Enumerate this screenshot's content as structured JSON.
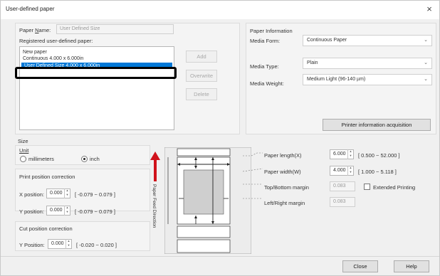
{
  "window": {
    "title": "User-defined paper",
    "close_glyph": "×"
  },
  "paper_name": {
    "label_pre": "Paper ",
    "label_key": "N",
    "label_post": "ame:",
    "value": "User Defined Size"
  },
  "registered": {
    "label": "Registered user-defined paper:",
    "items": [
      "New paper",
      "Continuous 4.000 x 6.000in",
      "User Defined Size 4.000 x 6.000in"
    ],
    "selected_index": 2
  },
  "buttons": {
    "add": "Add",
    "overwrite": "Overwrite",
    "delete": "Delete",
    "printer_info": "Printer information acquisition",
    "close": "Close",
    "help": "Help"
  },
  "paper_info": {
    "group": "Paper Information",
    "media_form_label": "Media Form:",
    "media_form_value": "Continuous Paper",
    "media_type_label": "Media Type:",
    "media_type_value": "Plain",
    "media_weight_label": "Media Weight:",
    "media_weight_value": "Medium Light (96-140 µm)"
  },
  "size": {
    "group": "Size",
    "unit_label": "Unit",
    "unit_mm": "millimeters",
    "unit_inch": "inch",
    "unit_selected": "inch"
  },
  "print_pos": {
    "group": "Print position correction",
    "x_label": "X position:",
    "x_value": "0.000",
    "x_range": "[ -0.079  ~  0.079  ]",
    "y_label": "Y position:",
    "y_value": "0.000",
    "y_range": "[ -0.079  ~  0.079  ]"
  },
  "cut_pos": {
    "group": "Cut position correction",
    "y_label": "Y Position:",
    "y_value": "0.000",
    "y_range": "[ -0.020  ~  0.020  ]"
  },
  "diagram": {
    "feed_label": "Paper Feed Direction",
    "paper_length_label": "Paper length(X)",
    "paper_length_value": "6.000",
    "paper_length_range": "[  0.500   ~  52.000   ]",
    "paper_width_label": "Paper width(W)",
    "paper_width_value": "4.000",
    "paper_width_range": "[  1.000   ~  5.118   ]",
    "top_bottom_label": "Top/Bottom margin",
    "top_bottom_value": "0.083",
    "left_right_label": "Left/Right margin",
    "left_right_value": "0.083",
    "extended_label": "Extended Printing"
  },
  "colors": {
    "selection": "#0078d7",
    "arrow_red": "#d0121b",
    "highlight_box": "#000000"
  }
}
